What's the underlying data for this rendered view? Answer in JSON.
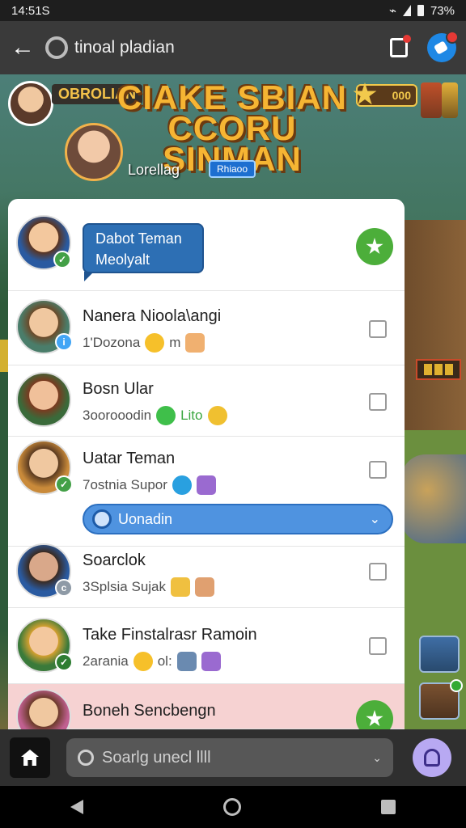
{
  "status_bar": {
    "time": "14:51S",
    "battery": "73%"
  },
  "app_bar": {
    "search_text": "tinoal pladian"
  },
  "game": {
    "header_label": "OBROLIAN",
    "title": "CIAKE SBIAN CCORU SINMAN",
    "hero_name": "Lorellag",
    "hero_chip": "Rhiaoo",
    "coins": "000"
  },
  "chat": {
    "rows": [
      {
        "bubble_line1": "Dabot Teman",
        "bubble_line2": "Meolyalt"
      },
      {
        "name": "Nanera Nioola\\angi",
        "sub": "1'Dozona",
        "sub_suffix": "m"
      },
      {
        "name": "Bosn Ular",
        "sub": "3oorooodin",
        "sub_suffix": "Lito"
      },
      {
        "name": "Uatar Teman",
        "sub": "7ostnia Supor"
      },
      {
        "name": "Soarclok",
        "sub": "3Splsia Sujak"
      },
      {
        "name": "Take Finstalrasr Ramoin",
        "sub": "2arania",
        "sub_suffix": "ol:"
      },
      {
        "name": "Boneh Sencbengn"
      }
    ],
    "pill_label": "Uonadin"
  },
  "bottom_bar": {
    "search_placeholder": "Soarlg unecl llll"
  },
  "colors": {
    "accent_green": "#4cae3a",
    "accent_blue": "#4f93e0",
    "highlight_pink": "#f6d2d2"
  }
}
